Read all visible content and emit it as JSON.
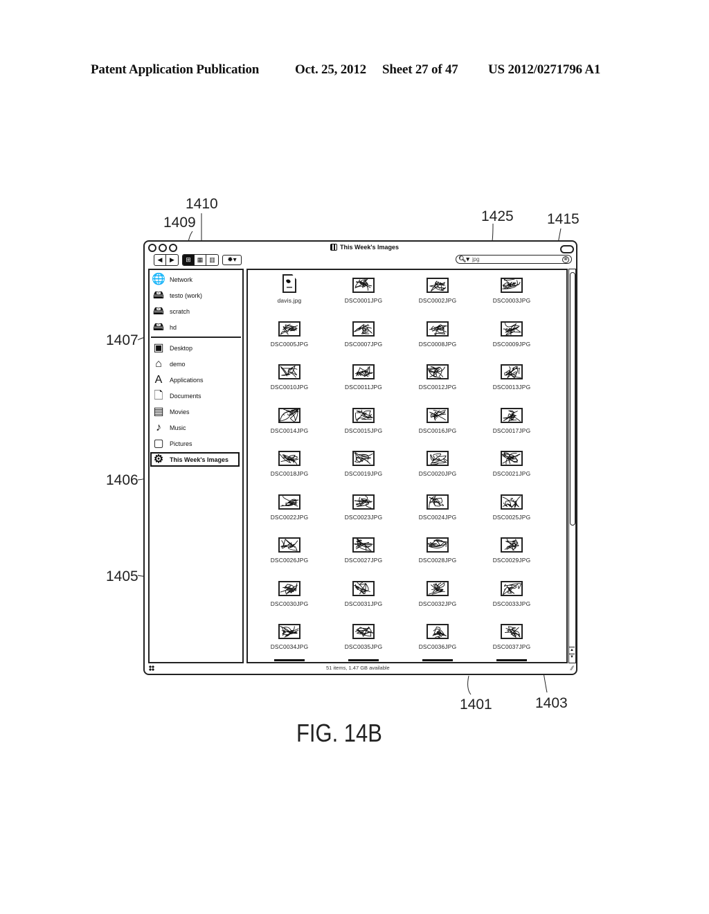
{
  "header": {
    "left": "Patent Application Publication",
    "date": "Oct. 25, 2012",
    "sheet": "Sheet 27 of 47",
    "number": "US 2012/0271796 A1"
  },
  "callouts": {
    "c1410": "1410",
    "c1409": "1409",
    "c1425": "1425",
    "c1415": "1415",
    "c1407": "1407",
    "c1406": "1406",
    "c1405": "1405",
    "c1401": "1401",
    "c1403": "1403"
  },
  "figure_label": "FIG. 14B",
  "window": {
    "title": "This Week's Images",
    "toolbar": {
      "back": "◀",
      "forward": "▶",
      "view_icon": "⊞",
      "view_list": "▦",
      "view_column": "▥",
      "action": "✹▾"
    },
    "search": {
      "icon": "search-icon",
      "value": "jpg",
      "clear": "⊗"
    },
    "sidebar": {
      "devices": [
        {
          "label": "Network",
          "icon": "globe-icon",
          "glyph": "🌐"
        },
        {
          "label": "testo (work)",
          "icon": "hard-drive-icon",
          "glyph": "🖴"
        },
        {
          "label": "scratch",
          "icon": "hard-drive-icon",
          "glyph": "🖴"
        },
        {
          "label": "hd",
          "icon": "hard-drive-icon",
          "glyph": "🖴"
        }
      ],
      "places": [
        {
          "label": "Desktop",
          "icon": "desktop-icon",
          "glyph": "▣"
        },
        {
          "label": "demo",
          "icon": "home-icon",
          "glyph": "⌂"
        },
        {
          "label": "Applications",
          "icon": "applications-icon",
          "glyph": "A"
        },
        {
          "label": "Documents",
          "icon": "document-icon",
          "glyph": "🗋"
        },
        {
          "label": "Movies",
          "icon": "clapper-icon",
          "glyph": "▤"
        },
        {
          "label": "Music",
          "icon": "music-icon",
          "glyph": "♪"
        },
        {
          "label": "Pictures",
          "icon": "picture-frame-icon",
          "glyph": "▢"
        },
        {
          "label": "This Week's Images",
          "icon": "smart-folder-icon",
          "glyph": "⚙",
          "selected": true
        }
      ]
    },
    "files": [
      {
        "name": "davis.jpg",
        "type": "document"
      },
      {
        "name": "DSC0001JPG"
      },
      {
        "name": "DSC0002JPG"
      },
      {
        "name": "DSC0003JPG"
      },
      {
        "name": "DSC0005JPG"
      },
      {
        "name": "DSC0007JPG"
      },
      {
        "name": "DSC0008JPG"
      },
      {
        "name": "DSC0009JPG"
      },
      {
        "name": "DSC0010JPG"
      },
      {
        "name": "DSC0011JPG"
      },
      {
        "name": "DSC0012JPG"
      },
      {
        "name": "DSC0013JPG"
      },
      {
        "name": "DSC0014JPG"
      },
      {
        "name": "DSC0015JPG"
      },
      {
        "name": "DSC0016JPG"
      },
      {
        "name": "DSC0017JPG"
      },
      {
        "name": "DSC0018JPG"
      },
      {
        "name": "DSC0019JPG"
      },
      {
        "name": "DSC0020JPG"
      },
      {
        "name": "DSC0021JPG"
      },
      {
        "name": "DSC0022JPG"
      },
      {
        "name": "DSC0023JPG"
      },
      {
        "name": "DSC0024JPG"
      },
      {
        "name": "DSC0025JPG"
      },
      {
        "name": "DSC0026JPG"
      },
      {
        "name": "DSC0027JPG"
      },
      {
        "name": "DSC0028JPG"
      },
      {
        "name": "DSC0029JPG"
      },
      {
        "name": "DSC0030JPG"
      },
      {
        "name": "DSC0031JPG"
      },
      {
        "name": "DSC0032JPG"
      },
      {
        "name": "DSC0033JPG"
      },
      {
        "name": "DSC0034JPG"
      },
      {
        "name": "DSC0035JPG"
      },
      {
        "name": "DSC0036JPG"
      },
      {
        "name": "DSC0037JPG"
      }
    ],
    "status": "51 items, 1.47 GB available",
    "scroll": {
      "up": "▲",
      "down": "▼"
    }
  }
}
